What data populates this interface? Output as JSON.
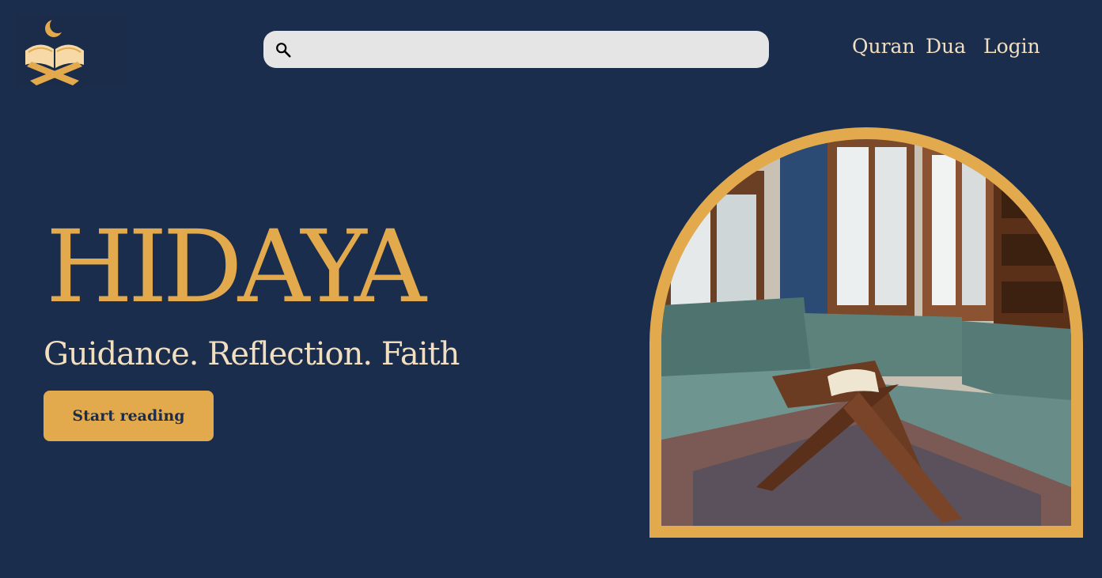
{
  "logo": {
    "icon": "quran-book-crescent-icon",
    "colors": {
      "gold": "#e3aa4d",
      "cream": "#f6d9a6"
    }
  },
  "search": {
    "icon": "search-icon",
    "placeholder": "",
    "value": ""
  },
  "nav": {
    "items": [
      {
        "label": "Quran"
      },
      {
        "label": "Dua"
      },
      {
        "label": "Login"
      }
    ]
  },
  "hero": {
    "title": "HIDAYA",
    "subtitle": "Guidance. Reflection. Faith",
    "cta_label": "Start reading"
  },
  "hero_image": {
    "subject": "room-with-quran-stand-photo"
  },
  "colors": {
    "background": "#1b2d4d",
    "accent": "#e3aa4d",
    "text_light": "#f1dfc0"
  }
}
